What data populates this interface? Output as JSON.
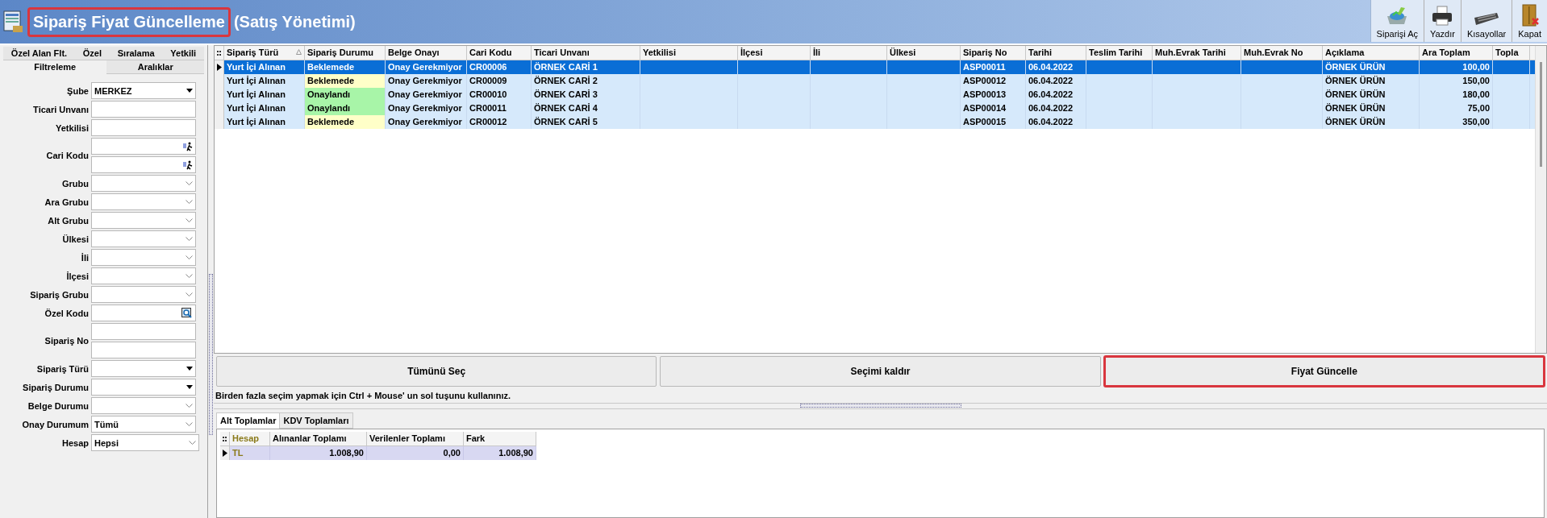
{
  "window": {
    "title": "Sipariş Fiyat Güncelleme",
    "subtitle": "(Satış Yönetimi)",
    "title_highlighted": true
  },
  "toolbar": [
    {
      "kind": "order",
      "label": "Siparişi Aç"
    },
    {
      "kind": "print",
      "label": "Yazdır"
    },
    {
      "kind": "keyboard",
      "label": "Kısayollar"
    },
    {
      "kind": "close",
      "label": "Kapat"
    }
  ],
  "filter_tabs": [
    [
      {
        "label": "Özel Alan Flt.",
        "selected": false
      },
      {
        "label": "Özel",
        "selected": false
      },
      {
        "label": "Sıralama",
        "selected": false
      },
      {
        "label": "Yetkili",
        "selected": false
      }
    ],
    [
      {
        "label": "Filtreleme",
        "selected": true
      },
      {
        "label": "Aralıklar",
        "selected": false
      }
    ]
  ],
  "filters": [
    {
      "label": "Şube",
      "inputs": [
        {
          "kind": "combo",
          "value": "MERKEZ"
        }
      ]
    },
    {
      "label": "Ticari Unvanı",
      "inputs": [
        {
          "kind": "text"
        }
      ]
    },
    {
      "label": "Yetkilisi",
      "inputs": [
        {
          "kind": "text"
        }
      ]
    },
    {
      "label": "Cari Kodu",
      "inputs": [
        {
          "kind": "lookup"
        },
        {
          "kind": "lookup"
        }
      ]
    },
    {
      "label": "Grubu",
      "inputs": [
        {
          "kind": "select"
        }
      ]
    },
    {
      "label": "Ara Grubu",
      "inputs": [
        {
          "kind": "select"
        }
      ]
    },
    {
      "label": "Alt Grubu",
      "inputs": [
        {
          "kind": "select"
        }
      ]
    },
    {
      "label": "Ülkesi",
      "inputs": [
        {
          "kind": "select"
        }
      ]
    },
    {
      "label": "İli",
      "inputs": [
        {
          "kind": "select"
        }
      ]
    },
    {
      "label": "İlçesi",
      "inputs": [
        {
          "kind": "select"
        }
      ]
    },
    {
      "label": "Sipariş Grubu",
      "inputs": [
        {
          "kind": "select"
        }
      ]
    },
    {
      "label": "Özel Kodu",
      "inputs": [
        {
          "kind": "search"
        }
      ]
    },
    {
      "label": "Sipariş No",
      "inputs": [
        {
          "kind": "text"
        },
        {
          "kind": "text"
        }
      ]
    },
    {
      "label": "Sipariş Türü",
      "inputs": [
        {
          "kind": "combo"
        }
      ]
    },
    {
      "label": "Sipariş Durumu",
      "inputs": [
        {
          "kind": "combo"
        }
      ]
    },
    {
      "label": "Belge Durumu",
      "inputs": [
        {
          "kind": "select"
        }
      ]
    },
    {
      "label": "Onay Durumum",
      "inputs": [
        {
          "kind": "select",
          "value": "Tümü"
        }
      ]
    },
    {
      "label": "Hesap",
      "inputs": [
        {
          "kind": "select",
          "value": "Hepsi"
        }
      ]
    }
  ],
  "orders": {
    "columns": [
      {
        "label": "Sipariş Türü",
        "sorted": true
      },
      {
        "label": "Sipariş Durumu",
        "sorted": false
      },
      {
        "label": "Belge Onayı",
        "sorted": false
      },
      {
        "label": "Cari Kodu",
        "sorted": false
      },
      {
        "label": "Ticari Unvanı",
        "sorted": false
      },
      {
        "label": "Yetkilisi",
        "sorted": false
      },
      {
        "label": "İlçesi",
        "sorted": false
      },
      {
        "label": "İli",
        "sorted": false
      },
      {
        "label": "Ülkesi",
        "sorted": false
      },
      {
        "label": "Sipariş No",
        "sorted": false
      },
      {
        "label": "Tarihi",
        "sorted": false
      },
      {
        "label": "Teslim Tarihi",
        "sorted": false
      },
      {
        "label": "Muh.Evrak Tarihi",
        "sorted": false
      },
      {
        "label": "Muh.Evrak No",
        "sorted": false
      },
      {
        "label": "Açıklama",
        "sorted": false
      },
      {
        "label": "Ara Toplam",
        "sorted": false
      },
      {
        "label": "Topla",
        "sorted": false
      }
    ],
    "rows": [
      {
        "selected": true,
        "cells": [
          "Yurt İçi Alınan",
          "Beklemede",
          "Onay Gerekmiyor",
          "CR00006",
          "ÖRNEK CARİ 1",
          "",
          "",
          "",
          "",
          "ASP00011",
          "06.04.2022",
          "",
          "",
          "",
          "ÖRNEK ÜRÜN",
          "100,00",
          ""
        ]
      },
      {
        "selected": false,
        "color": "#ffffc8",
        "cells": [
          "Yurt İçi Alınan",
          "Beklemede",
          "Onay Gerekmiyor",
          "CR00009",
          "ÖRNEK CARİ 2",
          "",
          "",
          "",
          "",
          "ASP00012",
          "06.04.2022",
          "",
          "",
          "",
          "ÖRNEK ÜRÜN",
          "150,00",
          ""
        ]
      },
      {
        "selected": false,
        "color": "#a8f5a8",
        "cells": [
          "Yurt İçi Alınan",
          "Onaylandı",
          "Onay Gerekmiyor",
          "CR00010",
          "ÖRNEK CARİ 3",
          "",
          "",
          "",
          "",
          "ASP00013",
          "06.04.2022",
          "",
          "",
          "",
          "ÖRNEK ÜRÜN",
          "180,00",
          ""
        ]
      },
      {
        "selected": false,
        "color": "#a8f5a8",
        "cells": [
          "Yurt İçi Alınan",
          "Onaylandı",
          "Onay Gerekmiyor",
          "CR00011",
          "ÖRNEK CARİ 4",
          "",
          "",
          "",
          "",
          "ASP00014",
          "06.04.2022",
          "",
          "",
          "",
          "ÖRNEK ÜRÜN",
          "75,00",
          ""
        ]
      },
      {
        "selected": false,
        "color": "#ffffc8",
        "cells": [
          "Yurt İçi Alınan",
          "Beklemede",
          "Onay Gerekmiyor",
          "CR00012",
          "ÖRNEK CARİ 5",
          "",
          "",
          "",
          "",
          "ASP00015",
          "06.04.2022",
          "",
          "",
          "",
          "ÖRNEK ÜRÜN",
          "350,00",
          ""
        ]
      }
    ]
  },
  "actions": [
    {
      "label": "Tümünü Seç",
      "highlighted": false
    },
    {
      "label": "Seçimi kaldır",
      "highlighted": false
    },
    {
      "label": "Fiyat Güncelle",
      "highlighted": true
    }
  ],
  "hint": "Birden fazla seçim yapmak için Ctrl + Mouse' un sol tuşunu kullanınız.",
  "totals_tabs": [
    {
      "label": "Alt Toplamlar",
      "selected": true
    },
    {
      "label": "KDV Toplamları",
      "selected": false
    }
  ],
  "totals": {
    "columns": [
      "Hesap",
      "Alınanlar Toplamı",
      "Verilenler Toplamı",
      "Fark"
    ],
    "rows": [
      [
        "TL",
        "1.008,90",
        "0,00",
        "1.008,90"
      ]
    ]
  }
}
